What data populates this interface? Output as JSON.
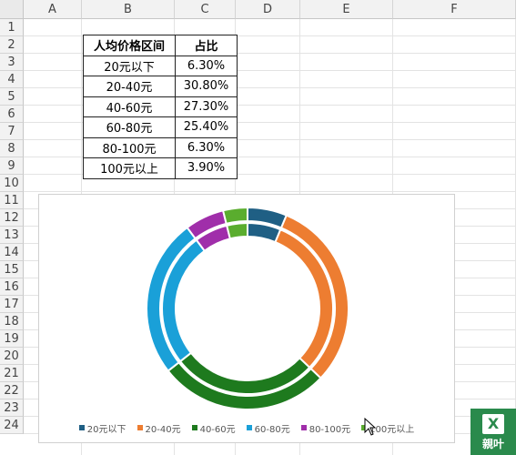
{
  "spreadsheet": {
    "columns": [
      "A",
      "B",
      "C",
      "D",
      "E",
      "F"
    ],
    "rows": [
      "1",
      "2",
      "3",
      "4",
      "5",
      "6",
      "7",
      "8",
      "9",
      "10",
      "11",
      "12",
      "13",
      "14",
      "15",
      "16",
      "17",
      "18",
      "19",
      "20",
      "21",
      "22",
      "23",
      "24"
    ],
    "table": {
      "headers": [
        "人均价格区间",
        "占比"
      ],
      "rows": [
        [
          "20元以下",
          "6.30%"
        ],
        [
          "20-40元",
          "30.80%"
        ],
        [
          "40-60元",
          "27.30%"
        ],
        [
          "60-80元",
          "25.40%"
        ],
        [
          "80-100元",
          "6.30%"
        ],
        [
          "100元以上",
          "3.90%"
        ]
      ]
    }
  },
  "chart_data": {
    "type": "pie",
    "variant": "double-ring-doughnut",
    "categories": [
      "20元以下",
      "20-40元",
      "40-60元",
      "60-80元",
      "80-100元",
      "100元以上"
    ],
    "values": [
      6.3,
      30.8,
      27.3,
      25.4,
      6.3,
      3.9
    ],
    "colors": [
      "#1f5f84",
      "#ed7d31",
      "#1e7a1e",
      "#1aa0d8",
      "#a02eaa",
      "#5aad2e"
    ],
    "legend": "bottom"
  },
  "badge": {
    "glyph": "X",
    "label": "親叶"
  },
  "icons": {
    "cursor": "pointer-cursor-icon"
  }
}
